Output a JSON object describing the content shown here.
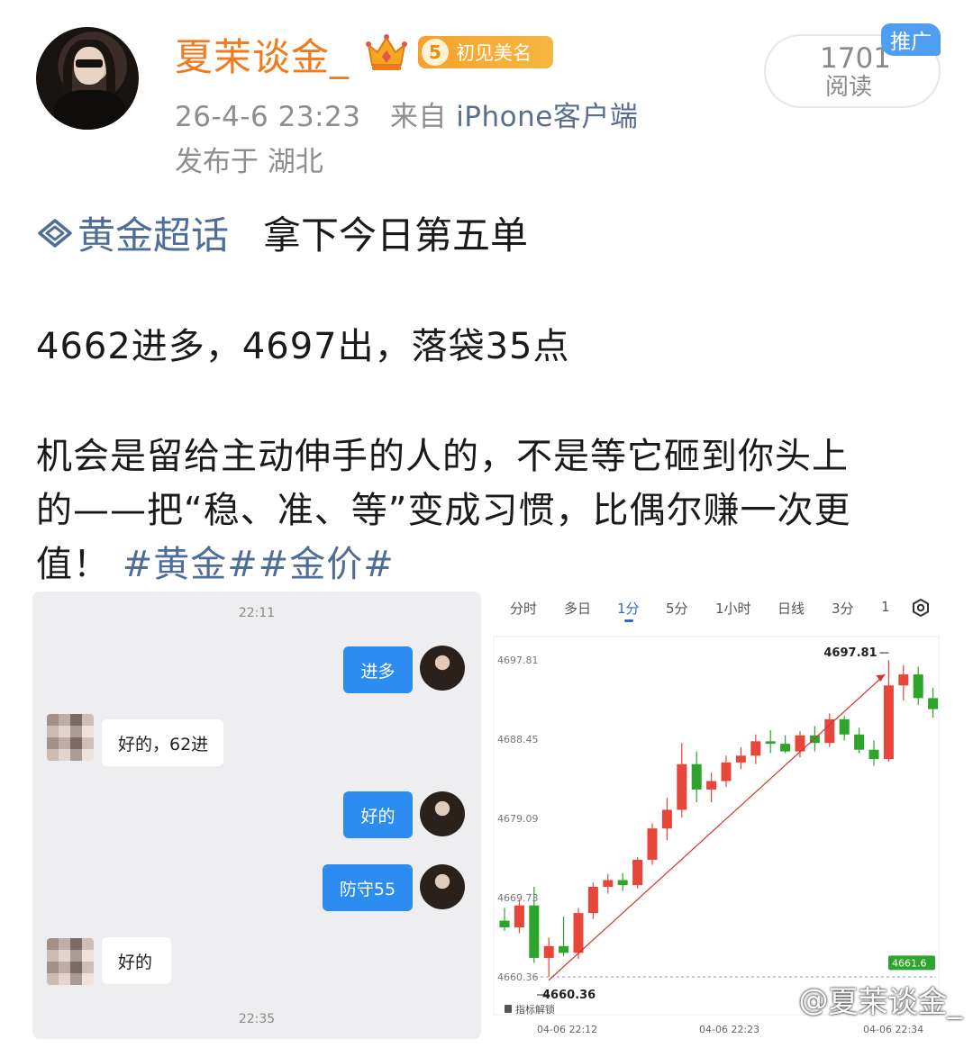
{
  "header": {
    "username": "夏茉谈金_",
    "vip_level": "5",
    "vip_label": "初见美名",
    "time": "26-4-6 23:23",
    "source_prefix": "来自",
    "source_client": "iPhone客户端",
    "location": "发布于 湖北",
    "read_count": "1701",
    "read_label": "阅读",
    "promo_tag": "推广"
  },
  "post": {
    "topic": "黄金超话",
    "title": "拿下今日第五单",
    "trade_line": "4662进多，4697出，落袋35点",
    "body_line1": "机会是留给主动伸手的人的，不是等它砸到你头上",
    "body_line2": "的——把“稳、准、等”变成习惯，比偶尔赚一次更",
    "body_line3": "值！",
    "hashtags": "#黄金##金价#"
  },
  "chat": {
    "time_top": "22:11",
    "time_bottom": "22:35",
    "messages": [
      {
        "side": "right",
        "text": "进多"
      },
      {
        "side": "left",
        "text": "好的，62进"
      },
      {
        "side": "right",
        "text": "好的"
      },
      {
        "side": "right",
        "text": "防守55"
      },
      {
        "side": "left",
        "text": "好的"
      }
    ]
  },
  "kline": {
    "tabs": [
      "分时",
      "多日",
      "1分",
      "5分",
      "1小时",
      "日线",
      "3分",
      "1"
    ],
    "active_tab": "1分",
    "y_labels": [
      "4697.81",
      "4688.45",
      "4679.09",
      "4669.73",
      "4660.36"
    ],
    "high_label": "4697.81",
    "low_label": "4660.36",
    "last_price_tag": "4661.6",
    "indicator_label": "指标解锁",
    "x_labels": [
      "04-06 22:12",
      "04-06 22:23",
      "04-06 22:34"
    ],
    "up_color": "#e8463a",
    "down_color": "#2da52d",
    "candles": [
      {
        "o": 4667.0,
        "h": 4668.5,
        "l": 4665.8,
        "c": 4666.2
      },
      {
        "o": 4666.2,
        "h": 4669.5,
        "l": 4665.5,
        "c": 4668.8
      },
      {
        "o": 4668.8,
        "h": 4671.0,
        "l": 4662.0,
        "c": 4662.6
      },
      {
        "o": 4662.6,
        "h": 4665.0,
        "l": 4660.4,
        "c": 4664.0
      },
      {
        "o": 4664.0,
        "h": 4667.5,
        "l": 4662.8,
        "c": 4663.2
      },
      {
        "o": 4663.2,
        "h": 4668.5,
        "l": 4662.5,
        "c": 4667.9
      },
      {
        "o": 4667.9,
        "h": 4671.5,
        "l": 4667.2,
        "c": 4671.0
      },
      {
        "o": 4671.0,
        "h": 4672.5,
        "l": 4670.2,
        "c": 4671.8
      },
      {
        "o": 4671.8,
        "h": 4672.6,
        "l": 4670.5,
        "c": 4671.2
      },
      {
        "o": 4671.2,
        "h": 4674.5,
        "l": 4670.8,
        "c": 4674.2
      },
      {
        "o": 4674.2,
        "h": 4678.5,
        "l": 4673.6,
        "c": 4677.9
      },
      {
        "o": 4677.9,
        "h": 4681.5,
        "l": 4676.5,
        "c": 4680.1
      },
      {
        "o": 4680.1,
        "h": 4688.0,
        "l": 4679.2,
        "c": 4685.5
      },
      {
        "o": 4685.5,
        "h": 4687.0,
        "l": 4681.0,
        "c": 4682.5
      },
      {
        "o": 4682.5,
        "h": 4684.5,
        "l": 4681.0,
        "c": 4683.5
      },
      {
        "o": 4683.5,
        "h": 4686.5,
        "l": 4682.8,
        "c": 4685.7
      },
      {
        "o": 4685.7,
        "h": 4687.5,
        "l": 4684.9,
        "c": 4686.5
      },
      {
        "o": 4686.5,
        "h": 4689.0,
        "l": 4685.5,
        "c": 4688.2
      },
      {
        "o": 4688.2,
        "h": 4689.5,
        "l": 4686.8,
        "c": 4687.9
      },
      {
        "o": 4687.9,
        "h": 4688.9,
        "l": 4686.8,
        "c": 4687.0
      },
      {
        "o": 4687.0,
        "h": 4689.4,
        "l": 4686.3,
        "c": 4688.9
      },
      {
        "o": 4688.9,
        "h": 4690.0,
        "l": 4687.0,
        "c": 4688.0
      },
      {
        "o": 4688.0,
        "h": 4691.5,
        "l": 4687.5,
        "c": 4690.8
      },
      {
        "o": 4690.8,
        "h": 4691.2,
        "l": 4688.3,
        "c": 4689.0
      },
      {
        "o": 4689.0,
        "h": 4689.8,
        "l": 4686.8,
        "c": 4687.2
      },
      {
        "o": 4687.2,
        "h": 4688.3,
        "l": 4685.3,
        "c": 4686.1
      },
      {
        "o": 4686.1,
        "h": 4697.8,
        "l": 4685.8,
        "c": 4694.8
      },
      {
        "o": 4694.8,
        "h": 4697.2,
        "l": 4693.0,
        "c": 4696.1
      },
      {
        "o": 4696.1,
        "h": 4697.0,
        "l": 4692.5,
        "c": 4693.3
      },
      {
        "o": 4693.3,
        "h": 4694.5,
        "l": 4691.0,
        "c": 4692.0
      }
    ]
  }
}
